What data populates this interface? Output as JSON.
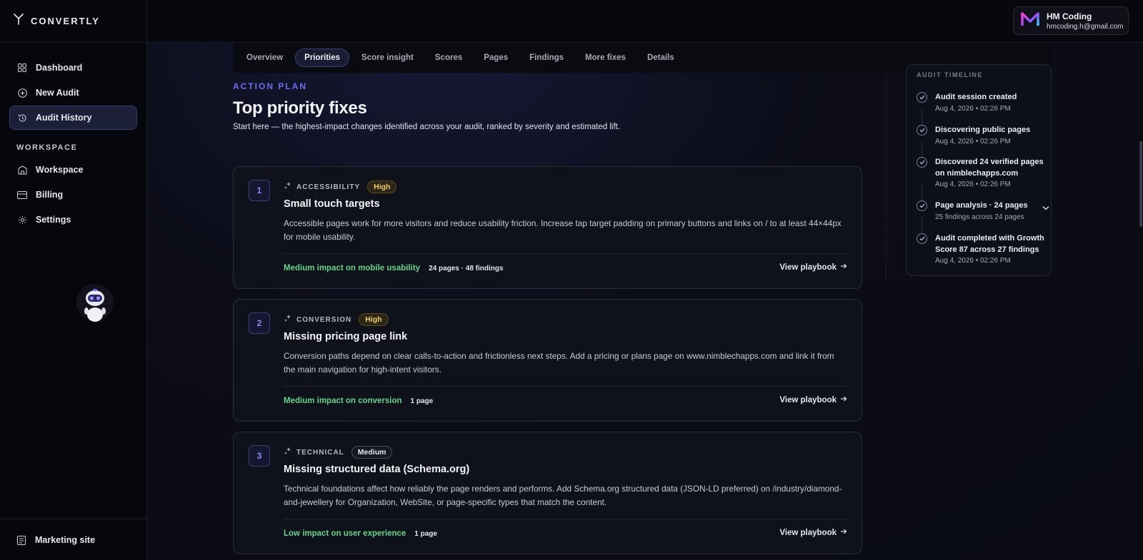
{
  "brand": {
    "name": "CONVERTLY",
    "icon": "branch-logo-icon"
  },
  "sidebar": {
    "items": [
      {
        "label": "Dashboard",
        "icon": "grid-icon"
      },
      {
        "label": "New Audit",
        "icon": "plus-circle-icon"
      },
      {
        "label": "Audit History",
        "icon": "history-icon",
        "active": true
      }
    ],
    "section_label": "WORKSPACE",
    "workspace_items": [
      {
        "label": "Workspace",
        "icon": "building-icon"
      },
      {
        "label": "Billing",
        "icon": "credit-card-icon"
      },
      {
        "label": "Settings",
        "icon": "gear-icon"
      }
    ],
    "bottom_item": {
      "label": "Marketing site",
      "icon": "clipboard-icon"
    }
  },
  "user": {
    "name": "HM Coding",
    "email": "hmcoding.h@gmail.com",
    "avatar_letter": "M"
  },
  "tabs": [
    {
      "label": "Overview"
    },
    {
      "label": "Priorities",
      "active": true
    },
    {
      "label": "Score insight"
    },
    {
      "label": "Scores"
    },
    {
      "label": "Pages"
    },
    {
      "label": "Findings"
    },
    {
      "label": "More fixes"
    },
    {
      "label": "Details"
    }
  ],
  "header": {
    "eyebrow": "ACTION PLAN",
    "title": "Top priority fixes",
    "subtitle": "Start here — the highest-impact changes identified across your audit, ranked by severity and estimated lift."
  },
  "cards": [
    {
      "number": "1",
      "category": "ACCESSIBILITY",
      "severity": "High",
      "title": "Small touch targets",
      "description": "Accessible pages work for more visitors and reduce usability friction. Increase tap target padding on primary buttons and links on / to at least 44×44px for mobile usability.",
      "impact": "Medium impact on mobile usability",
      "counts": "24 pages · 48 findings",
      "action": "View playbook"
    },
    {
      "number": "2",
      "category": "CONVERSION",
      "severity": "High",
      "title": "Missing pricing page link",
      "description": "Conversion paths depend on clear calls-to-action and frictionless next steps. Add a pricing or plans page on www.nimblechapps.com and link it from the main navigation for high-intent visitors.",
      "impact": "Medium impact on conversion",
      "counts": "1 page",
      "action": "View playbook"
    },
    {
      "number": "3",
      "category": "TECHNICAL",
      "severity": "Medium",
      "title": "Missing structured data (Schema.org)",
      "description": "Technical foundations affect how reliably the page renders and performs. Add Schema.org structured data (JSON-LD preferred) on /industry/diamond-and-jewellery for Organization, WebSite, or page-specific types that match the content.",
      "impact": "Low impact on user experience",
      "counts": "1 page",
      "action": "View playbook"
    }
  ],
  "timeline": {
    "heading": "AUDIT TIMELINE",
    "items": [
      {
        "title": "Audit session created",
        "time": "Aug 4, 2026 • 02:26 PM"
      },
      {
        "title": "Discovering public pages",
        "time": "Aug 4, 2026 • 02:26 PM"
      },
      {
        "title": "Discovered 24 verified pages on nimblechapps.com",
        "time": "Aug 4, 2026 • 02:26 PM"
      },
      {
        "title": "Page analysis · 24 pages",
        "time": "25 findings across 24 pages"
      },
      {
        "title": "Audit completed with Growth Score 87 across 27 findings",
        "time": "Aug 4, 2026 • 02:26 PM"
      }
    ]
  },
  "colors": {
    "accent": "#6f6cf5",
    "impact_green": "#5fd68a",
    "high_badge": "#f2cf6a",
    "background": "#0b0c14"
  }
}
